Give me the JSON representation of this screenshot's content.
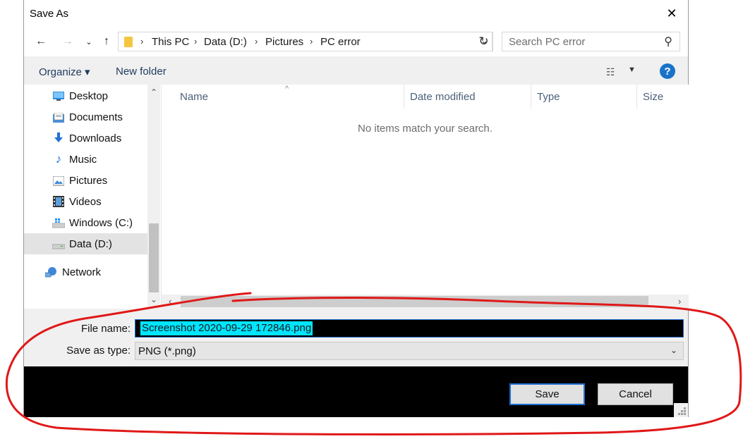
{
  "window": {
    "title": "Save As"
  },
  "nav": {
    "back_icon": "arrow-left-icon",
    "forward_icon": "arrow-right-icon",
    "recent_icon": "chevron-down-icon",
    "up_icon": "arrow-up-icon"
  },
  "address": {
    "crumbs": [
      "This PC",
      "Data (D:)",
      "Pictures",
      "PC error"
    ]
  },
  "search": {
    "placeholder": "Search PC error"
  },
  "toolbar": {
    "organize_label": "Organize ▾",
    "new_folder_label": "New folder"
  },
  "sidebar": {
    "items": [
      {
        "label": "Desktop",
        "icon": "desktop-icon"
      },
      {
        "label": "Documents",
        "icon": "documents-icon"
      },
      {
        "label": "Downloads",
        "icon": "downloads-icon"
      },
      {
        "label": "Music",
        "icon": "music-icon"
      },
      {
        "label": "Pictures",
        "icon": "pictures-icon"
      },
      {
        "label": "Videos",
        "icon": "videos-icon"
      },
      {
        "label": "Windows (C:)",
        "icon": "drive-icon"
      },
      {
        "label": "Data (D:)",
        "icon": "drive-icon",
        "selected": true
      },
      {
        "label": "Network",
        "icon": "network-icon"
      }
    ]
  },
  "filelist": {
    "columns": [
      "Name",
      "Date modified",
      "Type",
      "Size"
    ],
    "empty_message": "No items match your search."
  },
  "form": {
    "file_name_label": "File name:",
    "file_name_value": "Screenshot 2020-09-29 172846.png",
    "save_type_label": "Save as type:",
    "save_type_value": "PNG (*.png)"
  },
  "buttons": {
    "save_label": "Save",
    "cancel_label": "Cancel"
  },
  "colors": {
    "accent": "#1f6fd1",
    "selection": "#00e5ff",
    "annotation": "#e01818",
    "help": "#1a73c9"
  }
}
